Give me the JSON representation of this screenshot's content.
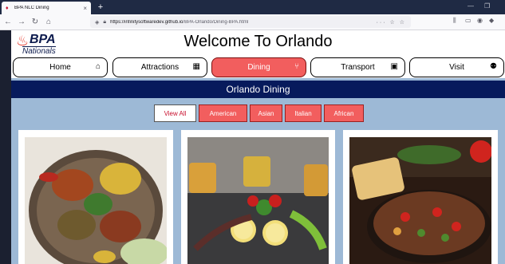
{
  "browser": {
    "tab_title": "BPA NLC Dining",
    "tab_close": "×",
    "new_tab": "+",
    "url_host": "https://infinitysoftwaredev.github.io",
    "url_path": "/BPA-Orlando/Dining-BPA.html",
    "url_actions": "··· ☆ ☆",
    "win_minimize": "—",
    "win_maximize": "❐"
  },
  "header": {
    "logo_main": "BPA",
    "logo_sub": "Nationals",
    "title": "Welcome To Orlando"
  },
  "nav": {
    "items": [
      {
        "label": "Home",
        "icon": "home-icon",
        "glyph": "⌂"
      },
      {
        "label": "Attractions",
        "icon": "building-icon",
        "glyph": "▦"
      },
      {
        "label": "Dining",
        "icon": "utensils-icon",
        "glyph": "⑂"
      },
      {
        "label": "Transport",
        "icon": "bus-icon",
        "glyph": "▣"
      },
      {
        "label": "Visit",
        "icon": "users-icon",
        "glyph": "⚉"
      }
    ],
    "active": "Dining"
  },
  "section": {
    "title": "Orlando Dining"
  },
  "filters": {
    "items": [
      "View All",
      "American",
      "Asian",
      "Italian",
      "African"
    ],
    "selected": "View All"
  },
  "colors": {
    "accent_red": "#f25e5e",
    "navy": "#071a5c",
    "page_bg": "#9db9d6"
  }
}
